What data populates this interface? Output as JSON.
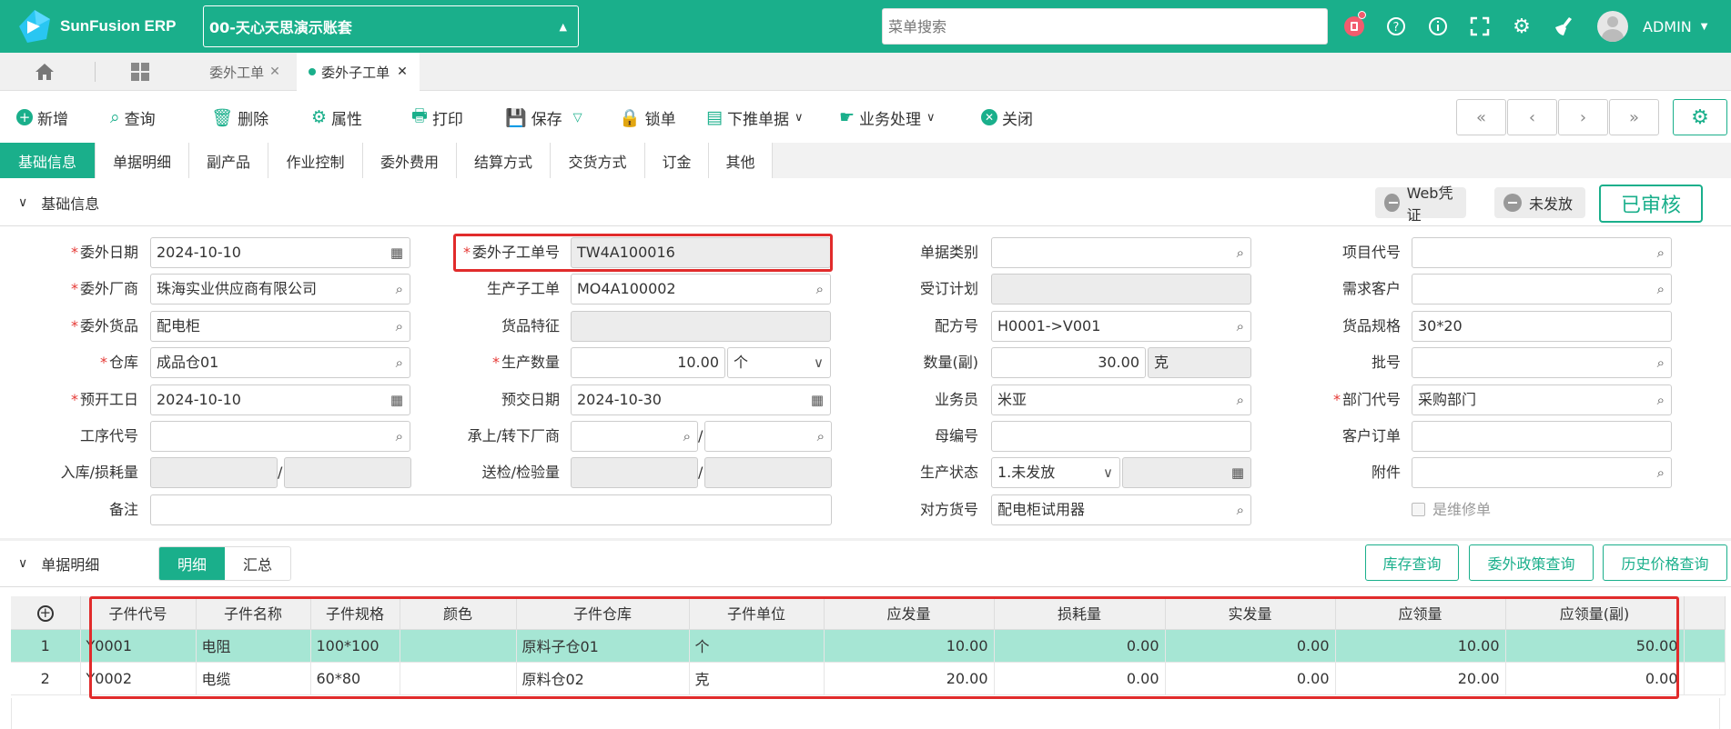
{
  "app": {
    "name": "SunFusion ERP",
    "company": "00-天心天思演示账套",
    "search_placeholder": "菜单搜索",
    "user": "ADMIN"
  },
  "tabs": [
    {
      "label": "委外工单"
    },
    {
      "label": "委外子工单"
    }
  ],
  "toolbar": {
    "add": "新增",
    "query": "查询",
    "delete": "删除",
    "props": "属性",
    "print": "打印",
    "save": "保存",
    "lock": "锁单",
    "push": "下推单据",
    "business": "业务处理",
    "close": "关闭"
  },
  "subtabs": [
    "基础信息",
    "单据明细",
    "副产品",
    "作业控制",
    "委外费用",
    "结算方式",
    "交货方式",
    "订金",
    "其他"
  ],
  "basic": {
    "section_title": "基础信息",
    "web_voucher": "Web凭证",
    "unissued": "未发放",
    "status": "已审核",
    "labels": {
      "outsrc_date": "委外日期",
      "sub_order_no": "委外子工单号",
      "doc_type": "单据类别",
      "project_code": "项目代号",
      "vendor": "委外厂商",
      "prod_sub_order": "生产子工单",
      "order_plan": "受订计划",
      "demand_customer": "需求客户",
      "goods": "委外货品",
      "goods_feature": "货品特征",
      "formula_no": "配方号",
      "goods_spec": "货品规格",
      "warehouse": "仓库",
      "prod_qty": "生产数量",
      "qty_sub": "数量(副)",
      "batch_no": "批号",
      "plan_start": "预开工日",
      "plan_delivery": "预交日期",
      "salesman": "业务员",
      "dept_code": "部门代号",
      "process_code": "工序代号",
      "upper_lower_vendor": "承上/转下厂商",
      "parent_no": "母编号",
      "customer_order": "客户订单",
      "in_loss_qty": "入库/损耗量",
      "inspect_qty": "送检/检验量",
      "prod_status": "生产状态",
      "attachment": "附件",
      "remark": "备注",
      "partner_goods": "对方货号",
      "is_repair": "是维修单"
    },
    "values": {
      "outsrc_date": "2024-10-10",
      "sub_order_no": "TW4A100016",
      "vendor": "珠海实业供应商有限公司",
      "prod_sub_order": "MO4A100002",
      "goods": "配电柜",
      "formula_no": "H0001->V001",
      "goods_spec": "30*20",
      "warehouse": "成品仓01",
      "prod_qty": "10.00",
      "prod_unit": "个",
      "qty_sub": "30.00",
      "qty_sub_unit": "克",
      "plan_start": "2024-10-10",
      "plan_delivery": "2024-10-30",
      "salesman": "米亚",
      "dept_code": "采购部门",
      "prod_status": "1.未发放",
      "partner_goods": "配电柜试用器"
    }
  },
  "detail": {
    "section_title": "单据明细",
    "view_detail": "明细",
    "view_summary": "汇总",
    "stock_query": "库存查询",
    "policy_query": "委外政策查询",
    "price_history": "历史价格查询",
    "columns": [
      "子件代号",
      "子件名称",
      "子件规格",
      "颜色",
      "子件仓库",
      "子件单位",
      "应发量",
      "损耗量",
      "实发量",
      "应领量",
      "应领量(副)"
    ],
    "rows": [
      {
        "idx": "1",
        "code": "Y0001",
        "name": "电阻",
        "spec": "100*100",
        "color": "",
        "wh": "原料子仓01",
        "unit": "个",
        "should_issue": "10.00",
        "loss": "0.00",
        "issued": "0.00",
        "should_take": "10.00",
        "should_take_sub": "50.00"
      },
      {
        "idx": "2",
        "code": "Y0002",
        "name": "电缆",
        "spec": "60*80",
        "color": "",
        "wh": "原料仓02",
        "unit": "克",
        "should_issue": "20.00",
        "loss": "0.00",
        "issued": "0.00",
        "should_take": "20.00",
        "should_take_sub": "0.00"
      }
    ]
  },
  "colors": {
    "primary": "#1aaf8b",
    "highlight_border": "#e12b2b",
    "selected_row": "#a6e6d4"
  }
}
